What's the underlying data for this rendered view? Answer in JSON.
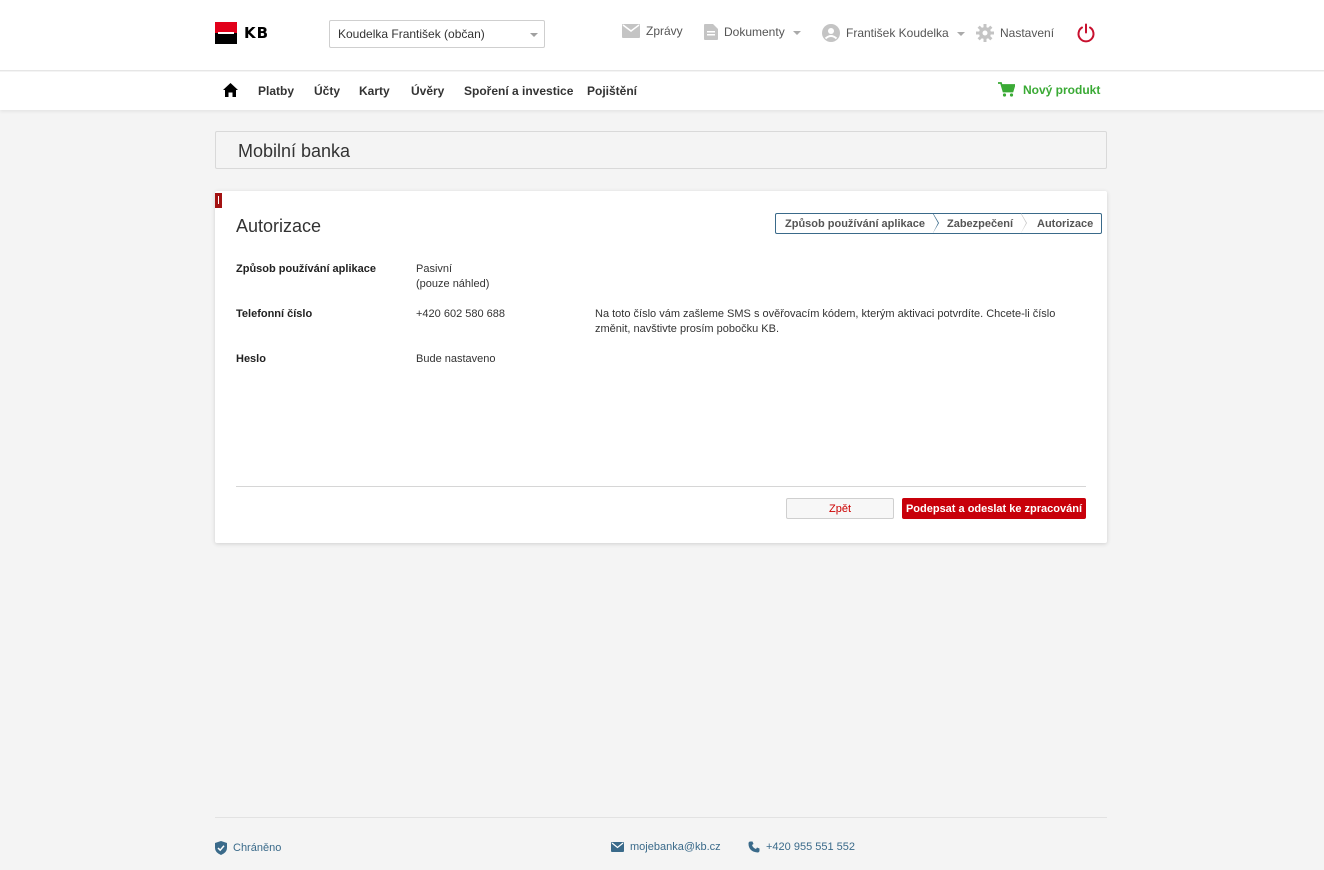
{
  "header": {
    "brand": "KB",
    "account_selector": "Koudelka František (občan)",
    "messages_label": "Zprávy",
    "documents_label": "Dokumenty",
    "user_label": "František Koudelka",
    "settings_label": "Nastavení"
  },
  "nav": {
    "items": [
      "Platby",
      "Účty",
      "Karty",
      "Úvěry",
      "Spoření a investice",
      "Pojištění"
    ],
    "new_product_label": "Nový produkt"
  },
  "page": {
    "title": "Mobilní banka"
  },
  "card": {
    "title": "Autorizace",
    "steps": [
      "Způsob používání aplikace",
      "Zabezpečení",
      "Autorizace"
    ],
    "rows": [
      {
        "label": "Způsob používání aplikace",
        "value_line1": "Pasivní",
        "value_line2": "(pouze náhled)"
      },
      {
        "label": "Telefonní číslo",
        "value": "+420 602 580 688",
        "note": "Na toto číslo vám zašleme SMS s ověřovacím kódem, kterým aktivaci potvrdíte. Chcete-li číslo změnit, navštivte prosím pobočku KB."
      },
      {
        "label": "Heslo",
        "value": "Bude nastaveno"
      }
    ],
    "back_label": "Zpět",
    "submit_label": "Podepsat a odeslat ke zpracování"
  },
  "footer": {
    "protected_label": "Chráněno",
    "email": "mojebanka@kb.cz",
    "phone": "+420 955 551 552"
  },
  "colors": {
    "brand_red": "#e2001a",
    "button_red": "#c8000a",
    "link_blue": "#3a6a8a",
    "new_product_green": "#3aaa35",
    "page_background": "#f4f4f4"
  }
}
